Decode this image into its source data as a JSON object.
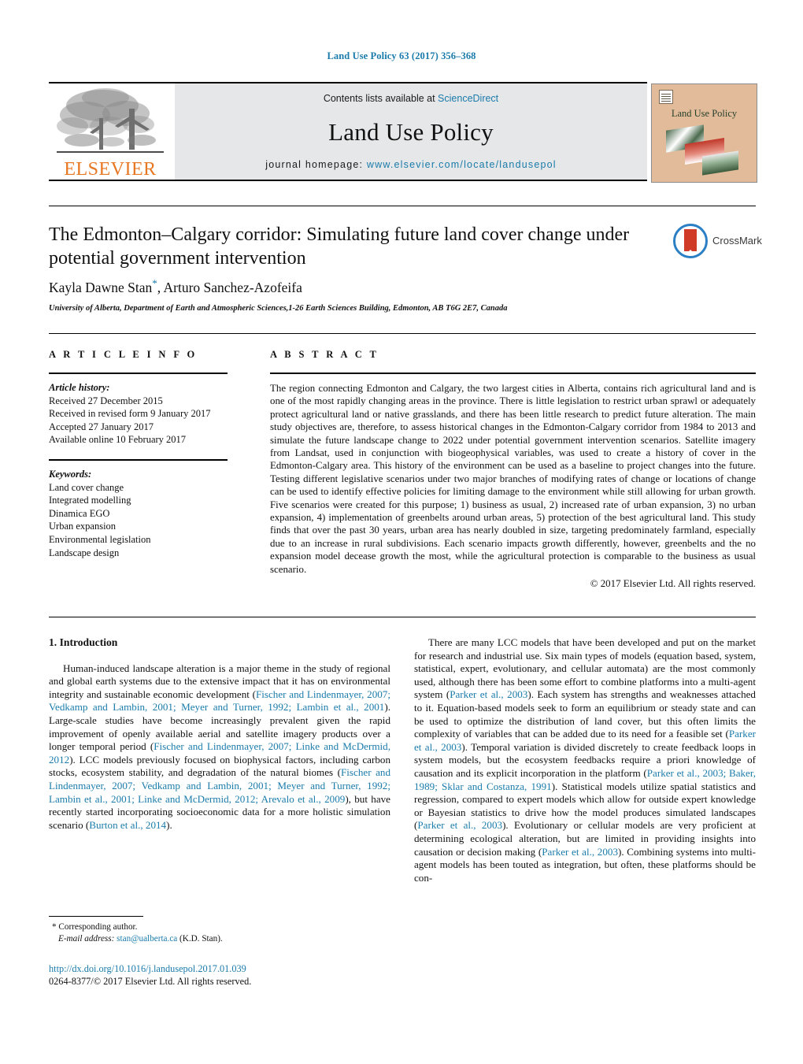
{
  "running_head": "Land Use Policy 63 (2017) 356–368",
  "masthead": {
    "contents_prefix": "Contents lists available at ",
    "contents_link": "ScienceDirect",
    "journal_title": "Land Use Policy",
    "homepage_prefix": "journal homepage: ",
    "homepage_url": "www.elsevier.com/locate/landusepol",
    "publisher_wordmark": "ELSEVIER",
    "cover_title": "Land Use Policy"
  },
  "title": {
    "line1": "The Edmonton–Calgary corridor: Simulating future land cover change",
    "line2": "under potential government intervention",
    "crossmark_label": "CrossMark"
  },
  "authors": {
    "names": "Kayla Dawne Stan",
    "corresponding_mark": "*",
    "names_rest": ", Arturo Sanchez-Azofeifa",
    "affiliation": "University of Alberta, Department of Earth and Atmospheric Sciences,1-26 Earth Sciences Building, Edmonton, AB T6G 2E7, Canada"
  },
  "article_info": {
    "heading": "A R T I C L E   I N F O",
    "history_label": "Article history:",
    "history": [
      "Received 27 December 2015",
      "Received in revised form 9 January 2017",
      "Accepted 27 January 2017",
      "Available online 10 February 2017"
    ],
    "keywords_label": "Keywords:",
    "keywords": [
      "Land cover change",
      "Integrated modelling",
      "Dinamica EGO",
      "Urban expansion",
      "Environmental legislation",
      "Landscape design"
    ]
  },
  "abstract": {
    "heading": "A B S T R A C T",
    "text": "The region connecting Edmonton and Calgary, the two largest cities in Alberta, contains rich agricultural land and is one of the most rapidly changing areas in the province. There is little legislation to restrict urban sprawl or adequately protect agricultural land or native grasslands, and there has been little research to predict future alteration. The main study objectives are, therefore, to assess historical changes in the Edmonton-Calgary corridor from 1984 to 2013 and simulate the future landscape change to 2022 under potential government intervention scenarios. Satellite imagery from Landsat, used in conjunction with biogeophysical variables, was used to create a history of cover in the Edmonton-Calgary area. This history of the environment can be used as a baseline to project changes into the future. Testing different legislative scenarios under two major branches of modifying rates of change or locations of change can be used to identify effective policies for limiting damage to the environment while still allowing for urban growth. Five scenarios were created for this purpose; 1) business as usual, 2) increased rate of urban expansion, 3) no urban expansion, 4) implementation of greenbelts around urban areas, 5) protection of the best agricultural land. This study finds that over the past 30 years, urban area has nearly doubled in size, targeting predominately farmland, especially due to an increase in rural subdivisions. Each scenario impacts growth differently, however, greenbelts and the no expansion model decease growth the most, while the agricultural protection is comparable to the business as usual scenario.",
    "copyright": "© 2017 Elsevier Ltd. All rights reserved."
  },
  "body": {
    "section_title": "1. Introduction",
    "left_para_1_a": "Human-induced landscape alteration is a major theme in the study of regional and global earth systems due to the extensive impact that it has on environmental integrity and sustainable economic development (",
    "left_cite_1": "Fischer and Lindenmayer, 2007; Vedkamp and Lambin, 2001; Meyer and Turner, 1992; Lambin et al., 2001",
    "left_para_1_b": "). Large-scale studies have become increasingly prevalent given the rapid improvement of openly available aerial and satellite imagery products over a longer temporal period (",
    "left_cite_2": "Fischer and Lindenmayer, 2007; Linke and McDermid, 2012",
    "left_para_1_c": "). LCC models previously focused on biophysical factors, including carbon stocks, ecosystem stability, and degradation of the natural biomes (",
    "left_cite_3": "Fischer and Lindenmayer, 2007; Vedkamp and Lambin, 2001; Meyer and Turner, 1992; Lambin et al., 2001; Linke and McDermid, 2012; Arevalo et al., 2009",
    "left_para_1_d": "), but have recently started incorporating socioeconomic data for a more holistic simulation scenario (",
    "left_cite_4": "Burton et al., 2014",
    "left_para_1_e": ").",
    "right_para_1_a": "There are many LCC models that have been developed and put on the market for research and industrial use. Six main types of models (equation based, system, statistical, expert, evolutionary, and cellular automata) are the most commonly used, although there has been some effort to combine platforms into a multi-agent system (",
    "right_cite_1": "Parker et al., 2003",
    "right_para_1_b": "). Each system has strengths and weaknesses attached to it. Equation-based models seek to form an equilibrium or steady state and can be used to optimize the distribution of land cover, but this often limits the complexity of variables that can be added due to its need for a feasible set (",
    "right_cite_2": "Parker et al., 2003",
    "right_para_1_c": "). Temporal variation is divided discretely to create feedback loops in system models, but the ecosystem feedbacks require a priori knowledge of causation and its explicit incorporation in the platform (",
    "right_cite_3": "Parker et al., 2003; Baker, 1989; Sklar and Costanza, 1991",
    "right_para_1_d": "). Statistical models utilize spatial statistics and regression, compared to expert models which allow for outside expert knowledge or Bayesian statistics to drive how the model produces simulated landscapes (",
    "right_cite_4": "Parker et al., 2003",
    "right_para_1_e": "). Evolutionary or cellular models are very proficient at determining ecological alteration, but are limited in providing insights into causation or decision making (",
    "right_cite_5": "Parker et al., 2003",
    "right_para_1_f": "). Combining systems into multi-agent models has been touted as integration, but often, these platforms should be con-"
  },
  "footnote": {
    "corresponding": "* Corresponding author.",
    "email_label": "E-mail address:",
    "email": "stan@ualberta.ca",
    "email_suffix": "(K.D. Stan)."
  },
  "doi": {
    "url": "http://dx.doi.org/10.1016/j.landusepol.2017.01.039",
    "issn_line": "0264-8377/© 2017 Elsevier Ltd. All rights reserved."
  },
  "colors": {
    "link_blue": "#1a7bab",
    "elsevier_orange": "#e87722",
    "masthead_grey": "#e6e7e8",
    "cover_tan": "#e2bc9a"
  }
}
